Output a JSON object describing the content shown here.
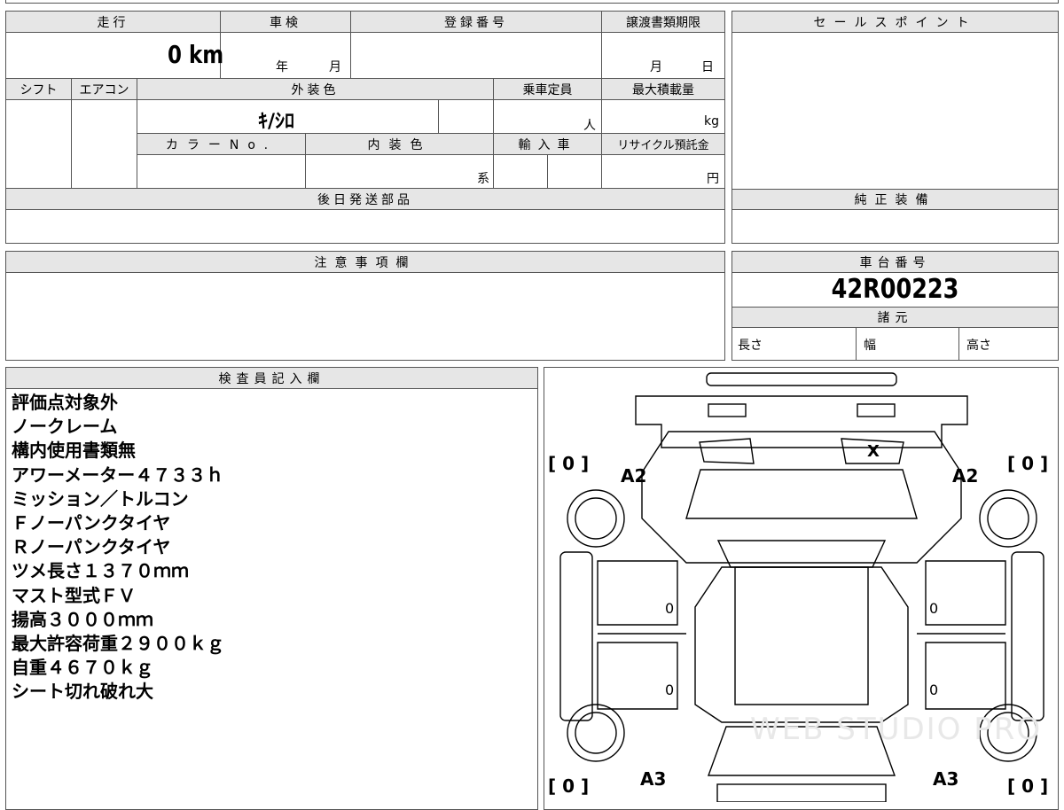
{
  "top": {
    "mileage_header": "走行",
    "inspection_header": "車検",
    "registration_header": "登録番号",
    "transfer_deadline_header": "譲渡書類期限",
    "mileage_value": "0 km",
    "inspection_year": "年",
    "inspection_month": "月",
    "deadline_month": "月",
    "deadline_day": "日",
    "shift_header": "シフト",
    "aircon_header": "エアコン",
    "exterior_color_header": "外装色",
    "exterior_color_value": "ｷ/ｼﾛ",
    "capacity_header": "乗車定員",
    "capacity_unit": "人",
    "max_load_header": "最大積載量",
    "max_load_unit": "kg",
    "color_no_header": "カラーNo.",
    "interior_color_header": "内装色",
    "interior_suffix": "系",
    "import_header": "輸入車",
    "recycle_header": "リサイクル預託金",
    "recycle_unit": "円",
    "later_parts_header": "後日発送部品",
    "sales_points_header": "セールスポイント",
    "genuine_equipment_header": "純正装備"
  },
  "notes": {
    "header": "注意事項欄"
  },
  "chassis": {
    "header": "車台番号",
    "number": "42R00223",
    "specs_header": "諸元",
    "length_label": "長さ",
    "width_label": "幅",
    "height_label": "高さ"
  },
  "inspector": {
    "header": "検査員記入欄",
    "lines": [
      "評価点対象外",
      "ノークレーム",
      "構内使用書類無",
      "アワーメーター４７３３ｈ",
      "ミッション／トルコン",
      "Ｆノーパンクタイヤ",
      "Ｒノーパンクタイヤ",
      "ツメ長さ１３７０ｍｍ",
      "マスト型式ＦＶ",
      "揚高３０００ｍｍ",
      "最大許容荷重２９００ｋｇ",
      "自重４６７０ｋｇ",
      "シート切れ破れ大"
    ]
  },
  "diagram": {
    "tire_fl": "[ 0 ]",
    "tire_fr": "[ 0 ]",
    "tire_rl": "[ 0 ]",
    "tire_rr": "[ 0 ]",
    "label_a2_left": "A2",
    "label_a2_right": "A2",
    "label_a3_left": "A3",
    "label_a3_right": "A3",
    "mark_x": "X",
    "door_fl": "0",
    "door_fr": "0",
    "door_rl": "0",
    "door_rr": "0",
    "watermark": "WEB STUDIO PRO"
  }
}
